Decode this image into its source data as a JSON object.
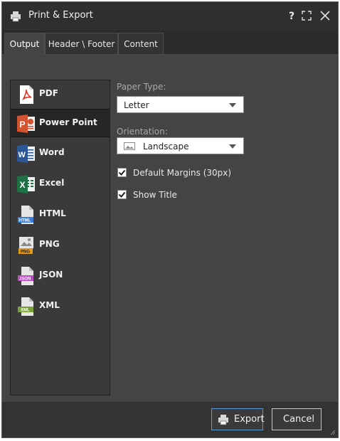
{
  "window": {
    "title": "Print & Export",
    "help_glyph": "?",
    "maximize_icon": "maximize-icon",
    "close_icon": "close-icon"
  },
  "tabs": [
    {
      "label": "Output",
      "active": true
    },
    {
      "label": "Header \\ Footer",
      "active": false
    },
    {
      "label": "Content",
      "active": false
    }
  ],
  "formats": [
    {
      "label": "PDF",
      "icon": "pdf-icon",
      "selected": false
    },
    {
      "label": "Power Point",
      "icon": "powerpoint-icon",
      "selected": true
    },
    {
      "label": "Word",
      "icon": "word-icon",
      "selected": false
    },
    {
      "label": "Excel",
      "icon": "excel-icon",
      "selected": false
    },
    {
      "label": "HTML",
      "icon": "html-icon",
      "selected": false
    },
    {
      "label": "PNG",
      "icon": "png-icon",
      "selected": false
    },
    {
      "label": "JSON",
      "icon": "json-icon",
      "selected": false
    },
    {
      "label": "XML",
      "icon": "xml-icon",
      "selected": false
    }
  ],
  "options": {
    "paper_type_label": "Paper Type:",
    "paper_type_value": "Letter",
    "orientation_label": "Orientation:",
    "orientation_value": "Landscape",
    "default_margins_label": "Default Margins (30px)",
    "default_margins_checked": true,
    "show_title_label": "Show Title",
    "show_title_checked": true
  },
  "footer": {
    "export_label": "Export",
    "cancel_label": "Cancel"
  },
  "colors": {
    "window_bg": "#3a3a3a",
    "titlebar_bg": "#2f2f2f",
    "content_bg": "#444444",
    "selected_item_bg": "#262626",
    "primary_button_border": "#5b9bd5",
    "pdf_red": "#d9342b",
    "ppt_orange": "#d35230",
    "word_blue": "#2b5797",
    "excel_green": "#1f7244"
  }
}
